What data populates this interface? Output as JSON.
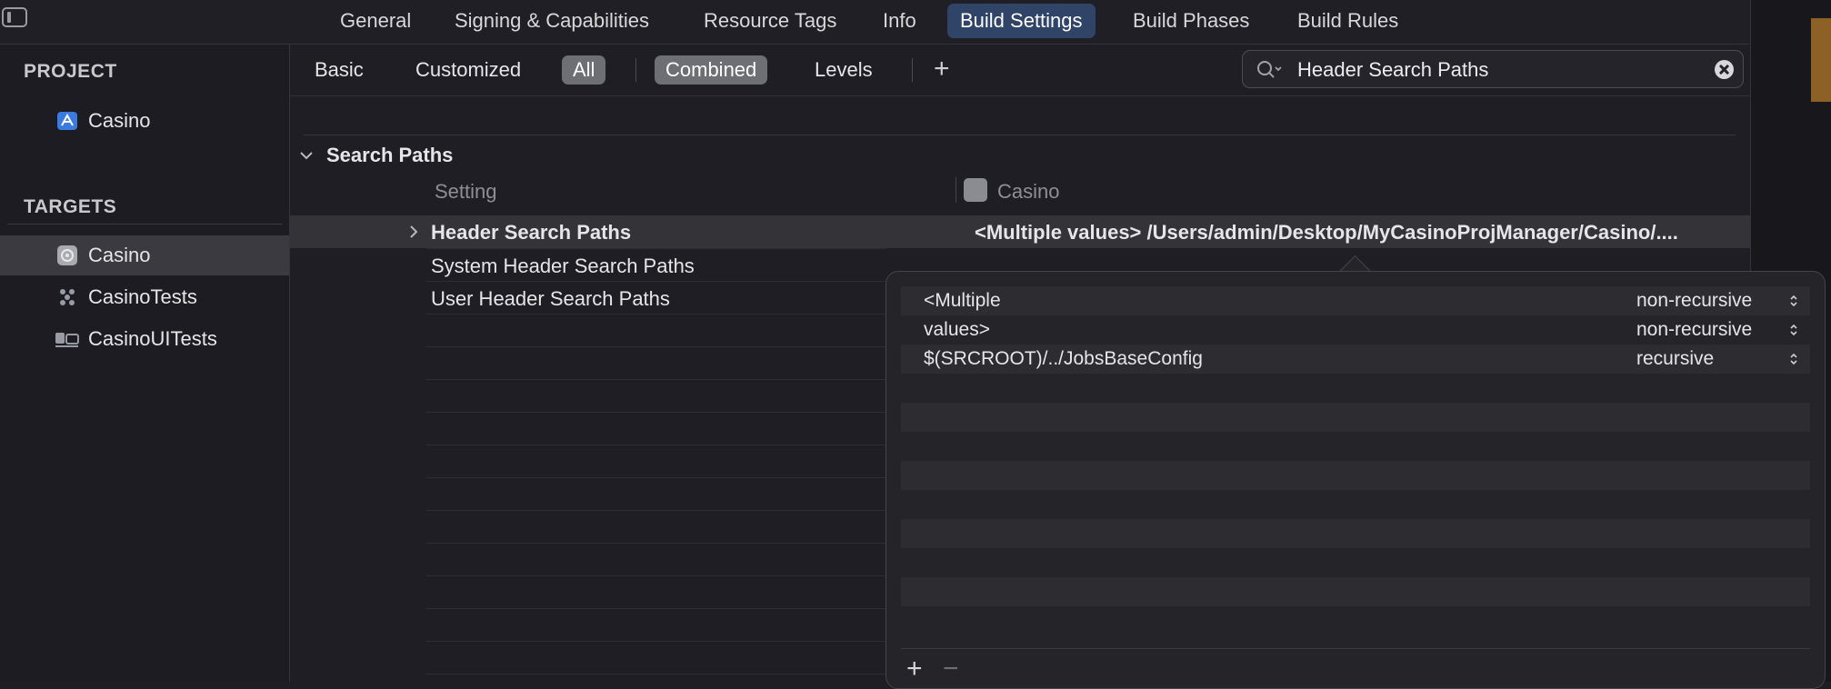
{
  "top_tabs": [
    "General",
    "Signing & Capabilities",
    "Resource Tags",
    "Info",
    "Build Settings",
    "Build Phases",
    "Build Rules"
  ],
  "sidebar": {
    "project_title": "PROJECT",
    "project_item": "Casino",
    "targets_title": "TARGETS",
    "targets": [
      "Casino",
      "CasinoTests",
      "CasinoUITests"
    ]
  },
  "filters": {
    "basic": "Basic",
    "customized": "Customized",
    "all": "All",
    "combined": "Combined",
    "levels": "Levels",
    "add": "+"
  },
  "search": {
    "value": "Header Search Paths"
  },
  "section": {
    "title": "Search Paths",
    "col_setting": "Setting",
    "col_target": "Casino"
  },
  "settings_rows": [
    {
      "name": "Header Search Paths",
      "value": "<Multiple values> /Users/admin/Desktop/MyCasinoProjManager/Casino/...."
    },
    {
      "name": "System Header Search Paths",
      "value": ""
    },
    {
      "name": "User Header Search Paths",
      "value": ""
    }
  ],
  "popover": {
    "rows": [
      {
        "path": "<Multiple",
        "mode": "non-recursive"
      },
      {
        "path": "values>",
        "mode": "non-recursive"
      },
      {
        "path": "$(SRCROOT)/../JobsBaseConfig",
        "mode": "recursive"
      }
    ],
    "add_label": "+",
    "remove_label": "−"
  },
  "colors": {
    "accent_tab": "#2f4466",
    "selected_row": "#333338",
    "filter_active": "#6e6e75"
  }
}
